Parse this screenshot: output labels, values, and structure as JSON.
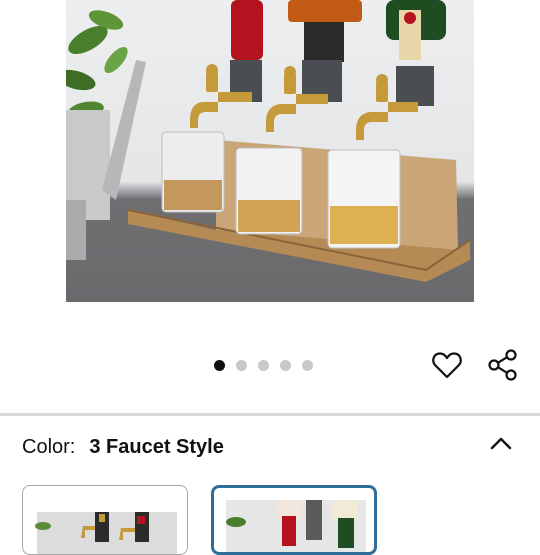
{
  "product": {
    "image": {
      "description_icon": "whiskey-dispenser-photo"
    },
    "carousel": {
      "count": 5,
      "active": 1
    }
  },
  "actions": {
    "favorite_icon": "heart-icon",
    "share_icon": "share-icon"
  },
  "variation": {
    "label": "Color:",
    "selected": "3 Faucet Style",
    "collapse_icon": "chevron-up-icon",
    "options": [
      {
        "icon": "two-faucet-thumbnail",
        "selected": false
      },
      {
        "icon": "three-faucet-thumbnail",
        "selected": true
      }
    ]
  },
  "colors": {
    "accent_border": "#2f6e99",
    "dot_active": "#111111",
    "dot_inactive": "#c8c8c8"
  }
}
